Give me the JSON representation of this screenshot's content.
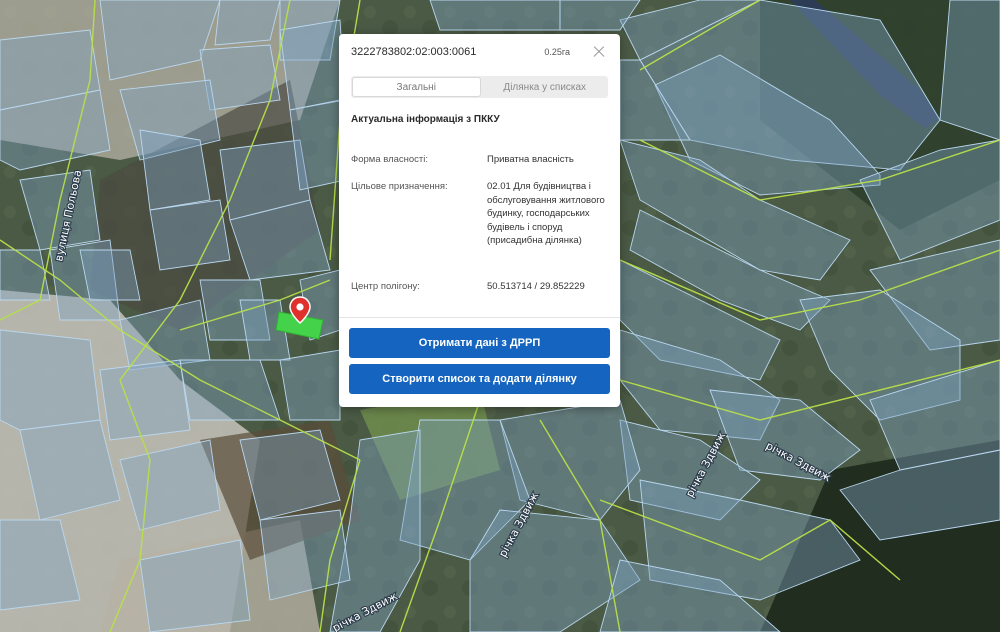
{
  "popup": {
    "cadastral_number": "3222783802:02:003:0061",
    "area": "0.25га",
    "tabs": [
      {
        "label": "Загальні",
        "active": true
      },
      {
        "label": "Ділянка у списках",
        "active": false
      }
    ],
    "section_title": "Актуальна інформація з ПККУ",
    "fields": [
      {
        "key": "Форма власності:",
        "value": "Приватна власність"
      },
      {
        "key": "Цільове призначення:",
        "value": "02.01 Для будівництва і обслуговування житлового будинку, господарських будівель і споруд (присадибна ділянка)"
      },
      {
        "key": "Центр полігону:",
        "value": "50.513714 / 29.852229"
      }
    ],
    "buttons": {
      "get_drrp": "Отримати дані з ДРРП",
      "create_list": "Створити список та додати ділянку"
    }
  },
  "map": {
    "road_labels": [
      "вулиця Польова",
      "річка Здвиж",
      "річка Здвиж",
      "річка Здвиж",
      "річка Здвиж"
    ],
    "colors": {
      "parcel_fill": "#7fa3c2",
      "parcel_stroke": "#b9d6ee",
      "boundary_line": "#b8e04a",
      "selected_parcel": "#44d24a",
      "marker": "#e0312d",
      "button": "#1565c0"
    }
  }
}
